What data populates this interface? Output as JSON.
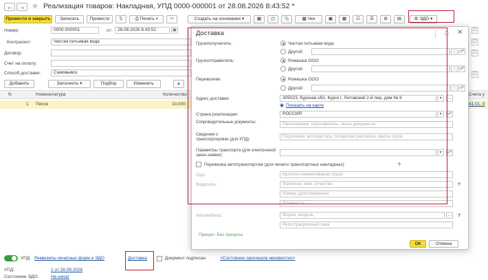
{
  "window": {
    "title": "Реализация товаров: Накладная, УПД 0000-000001 от 28.08.2026 8:43:52 *"
  },
  "toolbar": {
    "post_close": "Провести и закрыть",
    "save": "Записать",
    "post": "Провести",
    "print": "Печать",
    "create_based": "Создать на основании",
    "receipt": "Чек",
    "edo": "ЭДО"
  },
  "form": {
    "number_label": "Номер:",
    "number_value": "0000-000001",
    "date_label": "от:",
    "date_value": "28.08.2026  8:43:52",
    "counterparty_label": "Контрагент:",
    "counterparty_value": "Чистая питьевая вода",
    "contract_label": "Договор:",
    "invoice_label": "Счет на оплату:",
    "delivery_method_label": "Способ доставки:",
    "delivery_method_value": "Самовывоз"
  },
  "table_toolbar": {
    "add": "Добавить",
    "fill": "Заполнить",
    "pick": "Подбор",
    "change": "Изменить"
  },
  "table": {
    "col_n": "N",
    "col_nom": "Номенклатура",
    "col_qty": "Количество",
    "col_account": "Счета у",
    "rows": [
      {
        "n": "1",
        "name": "Песок",
        "qty": "10,000",
        "account": "41.01, 9"
      }
    ]
  },
  "dialog": {
    "title": "Доставка",
    "consignee_label": "Грузополучатель:",
    "consignee_value": "Чистая питьевая вода",
    "other_label": "Другой:",
    "shipper_label": "Грузоотправитель:",
    "shipper_value": "Ромашка ООО",
    "carrier_label": "Перевозчик:",
    "carrier_value": "Ромашка ООО",
    "address_label": "Адрес доставки:",
    "address_value": "305023, Курская обл, Курск г, Литовский 2-й пер, дом № 6",
    "show_map": "Показать на карте",
    "country_label": "Страна реализации:",
    "country_value": "РОССИЯ",
    "docs_label": "Сопроводительные документы:",
    "docs_placeholder": "Приложения, сертификаты, иные документы",
    "transport_info_label": "Сведения о транспортировке (для УПД):",
    "transport_info_placeholder": "Поручение экспедитору, складская расписка, масса груза",
    "transport_params_label": "Параметры транспорта (для электронной заказ-заявки):",
    "auto_transport_label": "Перевозка автотранспортом (для печати транспортных накладных)",
    "help_mark": "?",
    "cargo_label": "Груз:",
    "cargo_placeholder": "Краткое наименование груза",
    "driver_label": "Водитель:",
    "driver_name_placeholder": "Фамилия, имя, отчество",
    "license_placeholder": "Номер удостоверения",
    "position_placeholder": "Должность",
    "vehicle_label": "Автомобиль:",
    "vehicle_model_placeholder": "Марка, модель",
    "reg_sign_placeholder": "Регистрационный знак",
    "trailer_link": "Прицеп: Без прицепа",
    "ok": "ОК",
    "cancel": "Отмена"
  },
  "footer": {
    "upd_label": "УПД",
    "print_details_link": "Реквизиты печатных форм и ЭДО",
    "delivery_link": "Доставка",
    "signed_label": "Документ подписан",
    "original_state_link": "<Состояние оригинала неизвестно>",
    "upd_row_label": "УПД:",
    "upd_row_link": "1 от 28.08.2026",
    "edo_state_label": "Состояние ЭДО:",
    "edo_state_link": "Не начат"
  },
  "colors": {
    "accent_yellow": "#f5dc36",
    "highlight_red": "#c8102e",
    "selected_row": "#fbf3c4",
    "link": "#1a4fa0",
    "radio_on": "#3c9a3c"
  }
}
